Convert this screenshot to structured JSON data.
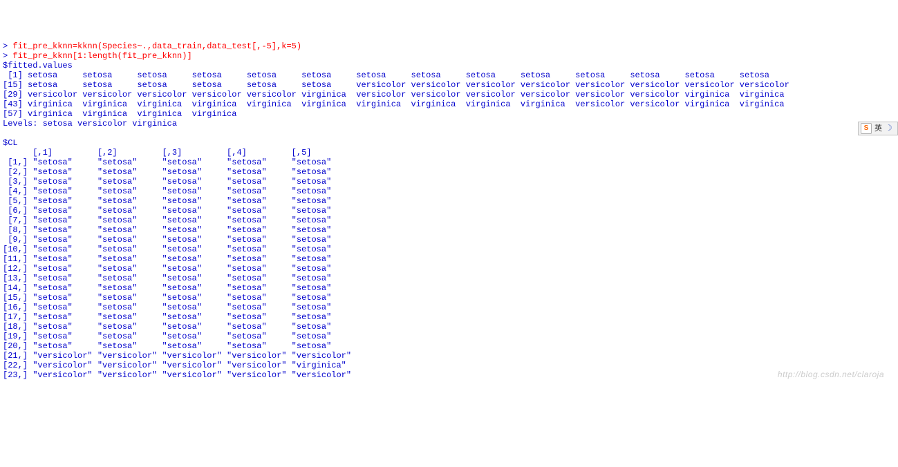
{
  "commands": [
    {
      "prompt": "> ",
      "text": "fit_pre_kknn=kknn(Species~.,data_train,data_test[,-5],k=5)"
    },
    {
      "prompt": "> ",
      "text": "fit_pre_kknn[1:length(fit_pre_kknn)]"
    }
  ],
  "fitted_header": "$fitted.values",
  "fitted_rows": [
    {
      "idx": " [1]",
      "vals": [
        "setosa",
        "setosa",
        "setosa",
        "setosa",
        "setosa",
        "setosa",
        "setosa",
        "setosa",
        "setosa",
        "setosa",
        "setosa",
        "setosa",
        "setosa",
        "setosa"
      ]
    },
    {
      "idx": "[15]",
      "vals": [
        "setosa",
        "setosa",
        "setosa",
        "setosa",
        "setosa",
        "setosa",
        "versicolor",
        "versicolor",
        "versicolor",
        "versicolor",
        "versicolor",
        "versicolor",
        "versicolor",
        "versicolor"
      ]
    },
    {
      "idx": "[29]",
      "vals": [
        "versicolor",
        "versicolor",
        "versicolor",
        "versicolor",
        "versicolor",
        "virginica",
        "versicolor",
        "versicolor",
        "versicolor",
        "versicolor",
        "versicolor",
        "versicolor",
        "virginica",
        "virginica"
      ]
    },
    {
      "idx": "[43]",
      "vals": [
        "virginica",
        "virginica",
        "virginica",
        "virginica",
        "virginica",
        "virginica",
        "virginica",
        "virginica",
        "virginica",
        "virginica",
        "versicolor",
        "versicolor",
        "virginica",
        "virginica"
      ]
    },
    {
      "idx": "[57]",
      "vals": [
        "virginica",
        "virginica",
        "virginica",
        "virginica"
      ]
    }
  ],
  "levels_line": "Levels: setosa versicolor virginica",
  "cl_header": "$CL",
  "cl_col_hdr": {
    "c1": "[,1]",
    "c2": "[,2]",
    "c3": "[,3]",
    "c4": "[,4]",
    "c5": "[,5]"
  },
  "cl_rows": [
    {
      "idx": " [1,]",
      "v": [
        "\"setosa\"",
        "\"setosa\"",
        "\"setosa\"",
        "\"setosa\"",
        "\"setosa\""
      ]
    },
    {
      "idx": " [2,]",
      "v": [
        "\"setosa\"",
        "\"setosa\"",
        "\"setosa\"",
        "\"setosa\"",
        "\"setosa\""
      ]
    },
    {
      "idx": " [3,]",
      "v": [
        "\"setosa\"",
        "\"setosa\"",
        "\"setosa\"",
        "\"setosa\"",
        "\"setosa\""
      ]
    },
    {
      "idx": " [4,]",
      "v": [
        "\"setosa\"",
        "\"setosa\"",
        "\"setosa\"",
        "\"setosa\"",
        "\"setosa\""
      ]
    },
    {
      "idx": " [5,]",
      "v": [
        "\"setosa\"",
        "\"setosa\"",
        "\"setosa\"",
        "\"setosa\"",
        "\"setosa\""
      ]
    },
    {
      "idx": " [6,]",
      "v": [
        "\"setosa\"",
        "\"setosa\"",
        "\"setosa\"",
        "\"setosa\"",
        "\"setosa\""
      ]
    },
    {
      "idx": " [7,]",
      "v": [
        "\"setosa\"",
        "\"setosa\"",
        "\"setosa\"",
        "\"setosa\"",
        "\"setosa\""
      ]
    },
    {
      "idx": " [8,]",
      "v": [
        "\"setosa\"",
        "\"setosa\"",
        "\"setosa\"",
        "\"setosa\"",
        "\"setosa\""
      ]
    },
    {
      "idx": " [9,]",
      "v": [
        "\"setosa\"",
        "\"setosa\"",
        "\"setosa\"",
        "\"setosa\"",
        "\"setosa\""
      ]
    },
    {
      "idx": "[10,]",
      "v": [
        "\"setosa\"",
        "\"setosa\"",
        "\"setosa\"",
        "\"setosa\"",
        "\"setosa\""
      ]
    },
    {
      "idx": "[11,]",
      "v": [
        "\"setosa\"",
        "\"setosa\"",
        "\"setosa\"",
        "\"setosa\"",
        "\"setosa\""
      ]
    },
    {
      "idx": "[12,]",
      "v": [
        "\"setosa\"",
        "\"setosa\"",
        "\"setosa\"",
        "\"setosa\"",
        "\"setosa\""
      ]
    },
    {
      "idx": "[13,]",
      "v": [
        "\"setosa\"",
        "\"setosa\"",
        "\"setosa\"",
        "\"setosa\"",
        "\"setosa\""
      ]
    },
    {
      "idx": "[14,]",
      "v": [
        "\"setosa\"",
        "\"setosa\"",
        "\"setosa\"",
        "\"setosa\"",
        "\"setosa\""
      ]
    },
    {
      "idx": "[15,]",
      "v": [
        "\"setosa\"",
        "\"setosa\"",
        "\"setosa\"",
        "\"setosa\"",
        "\"setosa\""
      ]
    },
    {
      "idx": "[16,]",
      "v": [
        "\"setosa\"",
        "\"setosa\"",
        "\"setosa\"",
        "\"setosa\"",
        "\"setosa\""
      ]
    },
    {
      "idx": "[17,]",
      "v": [
        "\"setosa\"",
        "\"setosa\"",
        "\"setosa\"",
        "\"setosa\"",
        "\"setosa\""
      ]
    },
    {
      "idx": "[18,]",
      "v": [
        "\"setosa\"",
        "\"setosa\"",
        "\"setosa\"",
        "\"setosa\"",
        "\"setosa\""
      ]
    },
    {
      "idx": "[19,]",
      "v": [
        "\"setosa\"",
        "\"setosa\"",
        "\"setosa\"",
        "\"setosa\"",
        "\"setosa\""
      ]
    },
    {
      "idx": "[20,]",
      "v": [
        "\"setosa\"",
        "\"setosa\"",
        "\"setosa\"",
        "\"setosa\"",
        "\"setosa\""
      ]
    },
    {
      "idx": "[21,]",
      "v": [
        "\"versicolor\"",
        "\"versicolor\"",
        "\"versicolor\"",
        "\"versicolor\"",
        "\"versicolor\""
      ]
    },
    {
      "idx": "[22,]",
      "v": [
        "\"versicolor\"",
        "\"versicolor\"",
        "\"versicolor\"",
        "\"versicolor\"",
        "\"virginica\""
      ]
    },
    {
      "idx": "[23,]",
      "v": [
        "\"versicolor\"",
        "\"versicolor\"",
        "\"versicolor\"",
        "\"versicolor\"",
        "\"versicolor\""
      ]
    }
  ],
  "watermark": "http://blog.csdn.net/claroja",
  "ime": {
    "logo": "S",
    "zh": "英"
  }
}
